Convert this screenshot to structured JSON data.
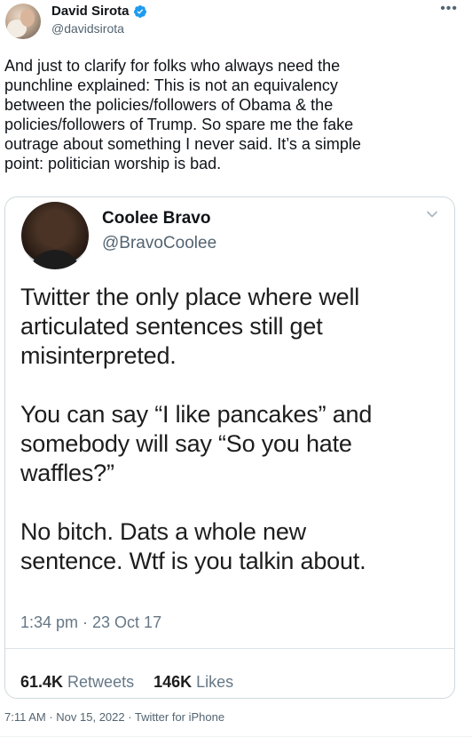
{
  "author": {
    "display_name": "David Sirota",
    "handle": "@davidsirota",
    "verified_color": "#1d9bf0"
  },
  "more_icon": "more-horizontal-icon",
  "tweet_text": "And just to clarify for folks who always need the\npunchline explained: This is not an equivalency\nbetween the policies/followers of Obama & the\npolicies/followers of Trump. So spare me the fake\noutrage about something I never said. It’s a simple\npoint: politician worship is bad.",
  "quoted": {
    "display_name": "Coolee Bravo",
    "handle": "@BravoCoolee",
    "body": "Twitter the only place where well\narticulated sentences still get\nmisinterpreted.\n\nYou can say “I like pancakes” and\nsomebody will say “So you hate\nwaffles?”\n\nNo bitch. Dats a whole new\nsentence. Wtf is you talkin about.",
    "timestamp": "1:34 pm · 23 Oct 17",
    "retweets_count": "61.4K",
    "retweets_label": "Retweets",
    "likes_count": "146K",
    "likes_label": "Likes"
  },
  "meta": "7:11 AM · Nov 15, 2022 · Twitter for iPhone"
}
